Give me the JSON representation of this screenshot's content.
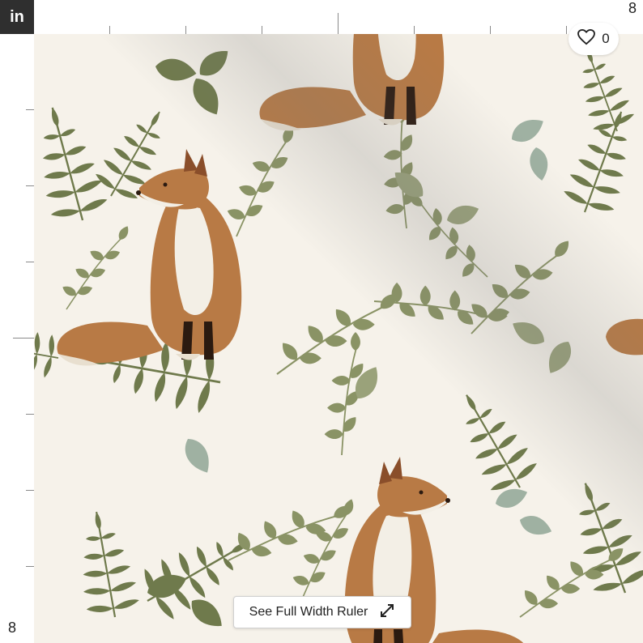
{
  "ruler": {
    "unit": "in",
    "top_end_label": "8",
    "left_end_label": "8"
  },
  "favorite": {
    "icon": "heart-outline-icon",
    "count": "0"
  },
  "ruler_button": {
    "label": "See Full Width Ruler",
    "icon": "expand-arrows-icon"
  },
  "colors": {
    "background": "#f6f2ea",
    "leaf_dark": "#6f7a4c",
    "leaf_light": "#9aa27a",
    "leaf_sage": "#9fb1a2",
    "fox_orange": "#b87a45",
    "fox_dark": "#8a4e2a"
  }
}
